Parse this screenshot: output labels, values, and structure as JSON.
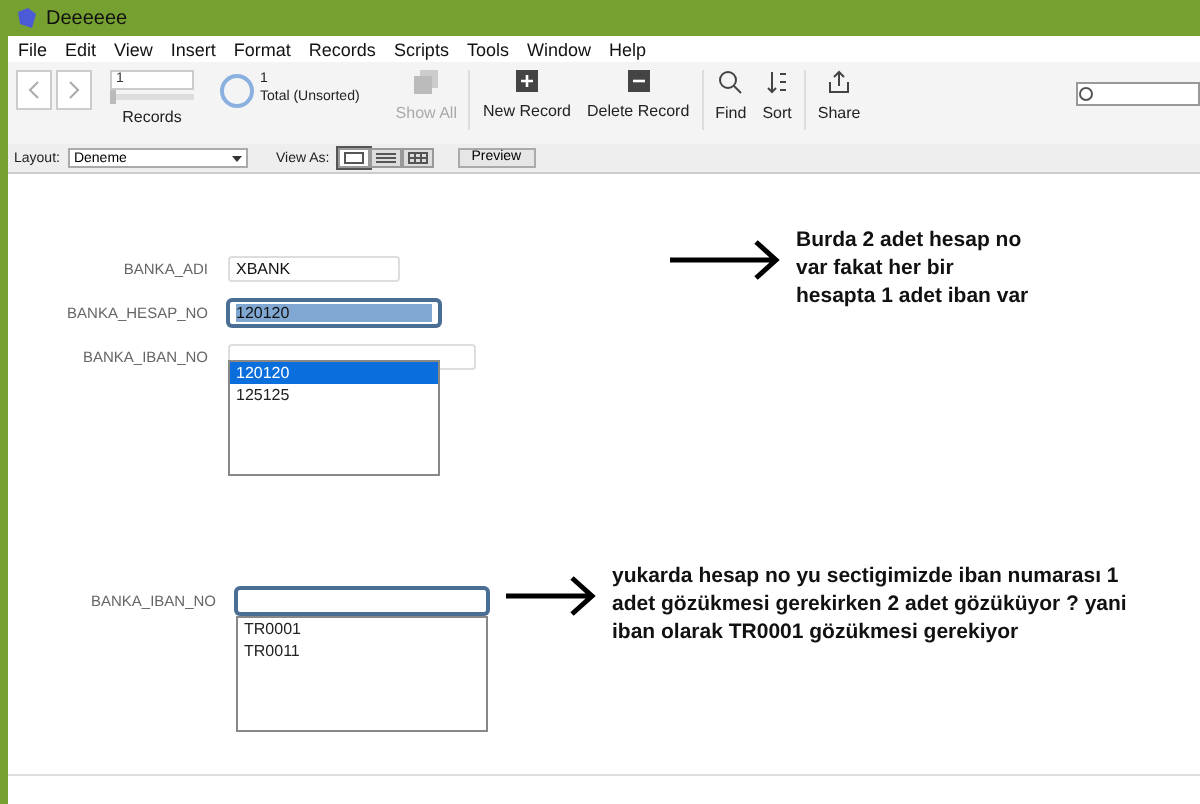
{
  "window": {
    "title": "Deeeeee"
  },
  "menu": [
    "File",
    "Edit",
    "View",
    "Insert",
    "Format",
    "Records",
    "Scripts",
    "Tools",
    "Window",
    "Help"
  ],
  "toolbar": {
    "record_number": "1",
    "record_slider": {
      "level": 0
    },
    "records_label": "Records",
    "found_count": "1",
    "total_label": "Total (Unsorted)",
    "buttons": [
      {
        "kind": "show_all",
        "label": "Show All",
        "disabled": true
      },
      {
        "kind": "new_record",
        "label": "New Record",
        "disabled": false
      },
      {
        "kind": "delete_record",
        "label": "Delete Record",
        "disabled": false
      },
      {
        "kind": "find",
        "label": "Find",
        "disabled": false
      },
      {
        "kind": "sort",
        "label": "Sort",
        "disabled": false
      },
      {
        "kind": "share",
        "label": "Share",
        "disabled": false
      }
    ]
  },
  "layout_bar": {
    "layout_label": "Layout:",
    "layout_value": "Deneme",
    "view_as_label": "View As:",
    "views": [
      {
        "kind": "form",
        "selected": true
      },
      {
        "kind": "list",
        "selected": false
      },
      {
        "kind": "table",
        "selected": false
      }
    ],
    "preview": "Preview"
  },
  "form_top": {
    "fields": [
      {
        "label": "BANKA_ADI",
        "value": "XBANK"
      },
      {
        "label": "BANKA_HESAP_NO",
        "value": "120120"
      },
      {
        "label": "BANKA_IBAN_NO"
      }
    ],
    "dropdown": [
      {
        "text": "120120",
        "selected": true
      },
      {
        "text": "125125",
        "selected": false
      }
    ],
    "note": "Burda 2 adet hesap no var fakat her bir hesapta 1 adet iban var"
  },
  "form_bottom": {
    "label": "BANKA_IBAN_NO",
    "dropdown": [
      {
        "text": "TR0001",
        "selected": false
      },
      {
        "text": "TR0011",
        "selected": false
      }
    ],
    "note": "yukarda hesap no yu sectigimizde iban numarası 1 adet gözükmesi gerekirken 2 adet gözüküyor ? yani iban olarak TR0001 gözükmesi gerekiyor"
  }
}
